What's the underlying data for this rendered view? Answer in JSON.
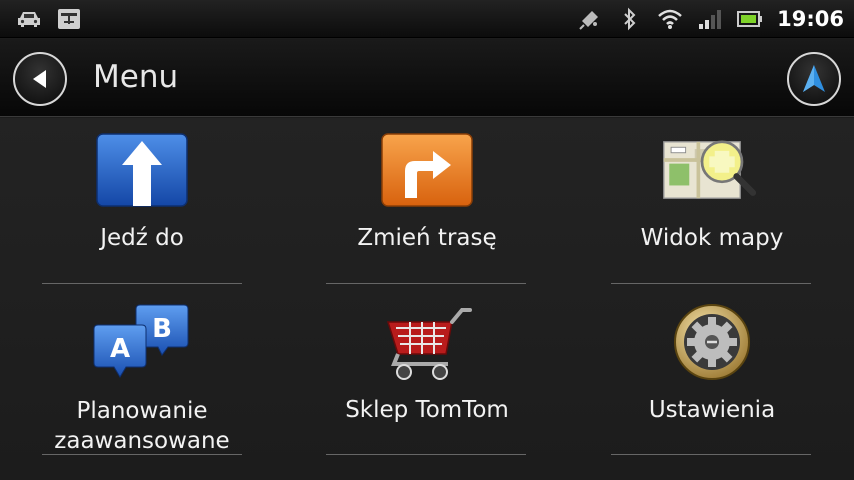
{
  "status": {
    "time": "19:06",
    "icons": [
      "car-icon",
      "usb-icon",
      "gps-icon",
      "bluetooth-icon",
      "wifi-icon",
      "signal-icon",
      "battery-icon"
    ]
  },
  "header": {
    "title": "Menu"
  },
  "menu": {
    "items": [
      {
        "label": "Jedź do",
        "icon": "drive-to-icon"
      },
      {
        "label": "Zmień trasę",
        "icon": "change-route-icon"
      },
      {
        "label": "Widok mapy",
        "icon": "map-view-icon"
      },
      {
        "label_line1": "Planowanie",
        "label_line2": "zaawansowane",
        "icon": "route-planning-icon"
      },
      {
        "label": "Sklep TomTom",
        "icon": "shop-cart-icon"
      },
      {
        "label": "Ustawienia",
        "icon": "settings-gear-icon"
      }
    ]
  },
  "colors": {
    "drive_blue": "#1f5fc4",
    "route_orange": "#e8791c",
    "nav_arrow": "#2f8fe0"
  }
}
